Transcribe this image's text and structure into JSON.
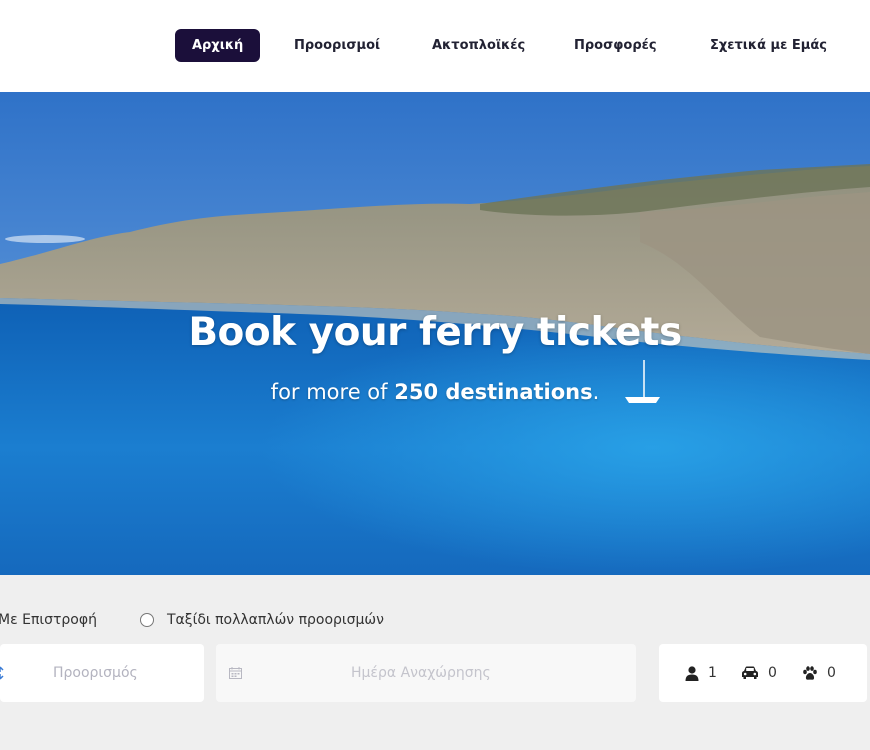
{
  "nav": {
    "items": [
      {
        "label": "Αρχική",
        "active": true
      },
      {
        "label": "Προορισμοί",
        "active": false
      },
      {
        "label": "Ακτοπλοϊκές",
        "active": false
      },
      {
        "label": "Προσφορές",
        "active": false
      },
      {
        "label": "Σχετικά με Εμάς",
        "active": false
      }
    ],
    "active_color": "#1b0f3a"
  },
  "hero": {
    "title": "Book your ferry tickets",
    "subtitle_prefix": "for more of ",
    "subtitle_bold": "250 destinations",
    "subtitle_suffix": "."
  },
  "search": {
    "trip_options": {
      "return_label": "Με Επιστροφή",
      "multi_label": "Ταξίδι πολλαπλών προορισμών"
    },
    "destination_placeholder": "Προορισμός",
    "departure_date_placeholder": "Ημέρα Αναχώρησης",
    "passengers": {
      "count": "1",
      "icon": "person-icon"
    },
    "vehicles": {
      "count": "0",
      "icon": "car-icon"
    },
    "pets": {
      "count": "0",
      "icon": "paw-icon"
    }
  }
}
